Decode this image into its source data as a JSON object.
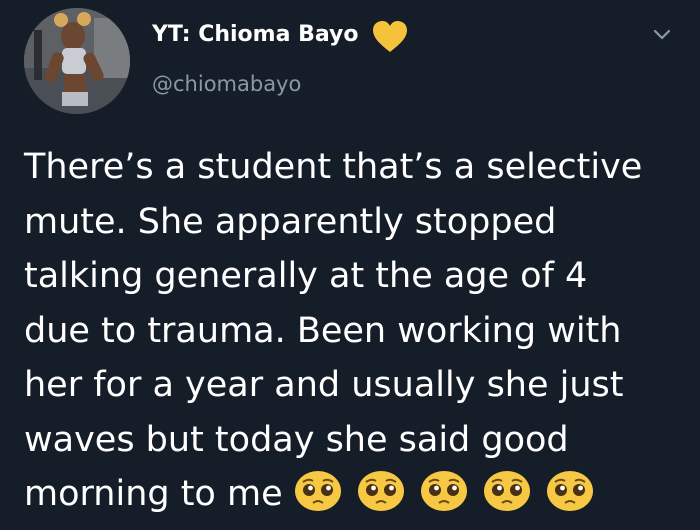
{
  "author": {
    "display_name": "YT: Chioma Bayo",
    "handle": "@chiomabayo",
    "badge_icon": "yellow-heart-icon",
    "badge_color": "#f5c33b"
  },
  "tweet": {
    "lines": [
      "There’s a student that’s a selective",
      "mute. She apparently stopped",
      "talking generally at the age of 4",
      "due to trauma. Been working with",
      "her for a year and usually she just",
      "waves but today she said good",
      "morning to me"
    ],
    "emojis": [
      "pleading-face-icon",
      "pleading-face-icon",
      "pleading-face-icon",
      "pleading-face-icon",
      "pleading-face-icon"
    ]
  },
  "menu_icon": "chevron-down-icon",
  "colors": {
    "background": "#151e28",
    "text": "#ffffff",
    "secondary_text": "#8899a6"
  }
}
